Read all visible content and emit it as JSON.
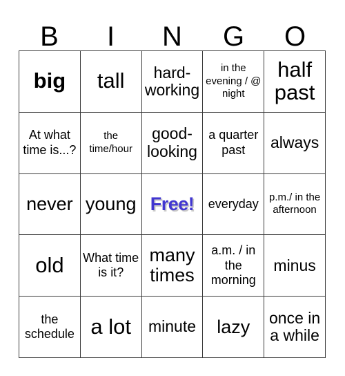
{
  "card": {
    "title": "BINGO",
    "header_letters": [
      "B",
      "I",
      "N",
      "G",
      "O"
    ],
    "columns": 5,
    "rows": 5,
    "free_space_color": "#4136d0",
    "border_color": "#3a3a3a",
    "background_color": "#ffffff",
    "text_color": "#000000"
  },
  "cells": [
    [
      {
        "text": "big",
        "size": "sz-xl",
        "bold": true,
        "free": false
      },
      {
        "text": "tall",
        "size": "sz-xl",
        "bold": false,
        "free": false
      },
      {
        "text": "hard-working",
        "size": "sz-md",
        "bold": false,
        "free": false
      },
      {
        "text": "in the evening / @ night",
        "size": "sz-xs",
        "bold": false,
        "free": false
      },
      {
        "text": "half past",
        "size": "sz-xl",
        "bold": false,
        "free": false
      }
    ],
    [
      {
        "text": "At what time is...?",
        "size": "sz-sm",
        "bold": false,
        "free": false
      },
      {
        "text": "the time/hour",
        "size": "sz-xs",
        "bold": false,
        "free": false
      },
      {
        "text": "good-looking",
        "size": "sz-md",
        "bold": false,
        "free": false
      },
      {
        "text": "a quarter past",
        "size": "sz-sm",
        "bold": false,
        "free": false
      },
      {
        "text": "always",
        "size": "sz-md",
        "bold": false,
        "free": false
      }
    ],
    [
      {
        "text": "never",
        "size": "sz-lg",
        "bold": false,
        "free": false
      },
      {
        "text": "young",
        "size": "sz-lg",
        "bold": false,
        "free": false
      },
      {
        "text": "Free!",
        "size": "sz-lg",
        "bold": true,
        "free": true
      },
      {
        "text": "everyday",
        "size": "sz-sm",
        "bold": false,
        "free": false
      },
      {
        "text": "p.m./ in the afternoon",
        "size": "sz-xs",
        "bold": false,
        "free": false
      }
    ],
    [
      {
        "text": "old",
        "size": "sz-xl",
        "bold": false,
        "free": false
      },
      {
        "text": "What time is it?",
        "size": "sz-sm",
        "bold": false,
        "free": false
      },
      {
        "text": "many times",
        "size": "sz-lg",
        "bold": false,
        "free": false
      },
      {
        "text": "a.m. / in the morning",
        "size": "sz-sm",
        "bold": false,
        "free": false
      },
      {
        "text": "minus",
        "size": "sz-md",
        "bold": false,
        "free": false
      }
    ],
    [
      {
        "text": "the schedule",
        "size": "sz-sm",
        "bold": false,
        "free": false
      },
      {
        "text": "a lot",
        "size": "sz-xl",
        "bold": false,
        "free": false
      },
      {
        "text": "minute",
        "size": "sz-md",
        "bold": false,
        "free": false
      },
      {
        "text": "lazy",
        "size": "sz-lg",
        "bold": false,
        "free": false
      },
      {
        "text": "once in a while",
        "size": "sz-md",
        "bold": false,
        "free": false
      }
    ]
  ]
}
